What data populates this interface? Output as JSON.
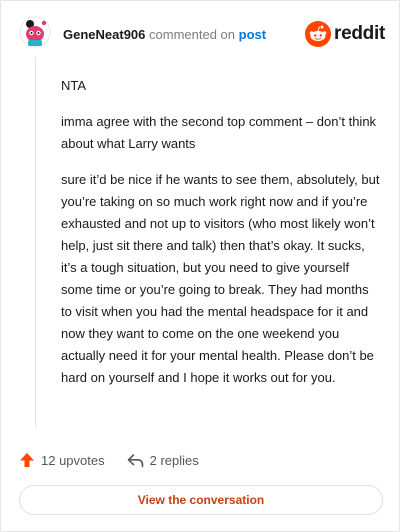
{
  "comment": {
    "author": "GeneNeat906",
    "commented_on_text": "commented on",
    "post_link": "post",
    "paragraphs": [
      "NTA",
      "imma agree with the second top comment – don’t think about what Larry wants",
      "sure it’d be nice if he wants to see them, absolutely, but you’re taking on so much work right now and if you’re exhausted and not up to visitors (who most likely won’t help, just sit there and talk) then that’s okay. It sucks, it’s a tough situation, but you need to give yourself some time or you’re going to break. They had months to visit when you had the mental headspace for it and now they want to come on the one weekend you actually need it for your mental health. Please don’t be hard on yourself and I hope it works out for you."
    ]
  },
  "brand": {
    "name": "reddit",
    "color": "#ff4500",
    "icon": "reddit-snoo-icon"
  },
  "actions": {
    "upvotes": "12 upvotes",
    "replies": "2 replies",
    "upvote_color": "#ff4500"
  },
  "view_button": {
    "label": "View the conversation"
  }
}
